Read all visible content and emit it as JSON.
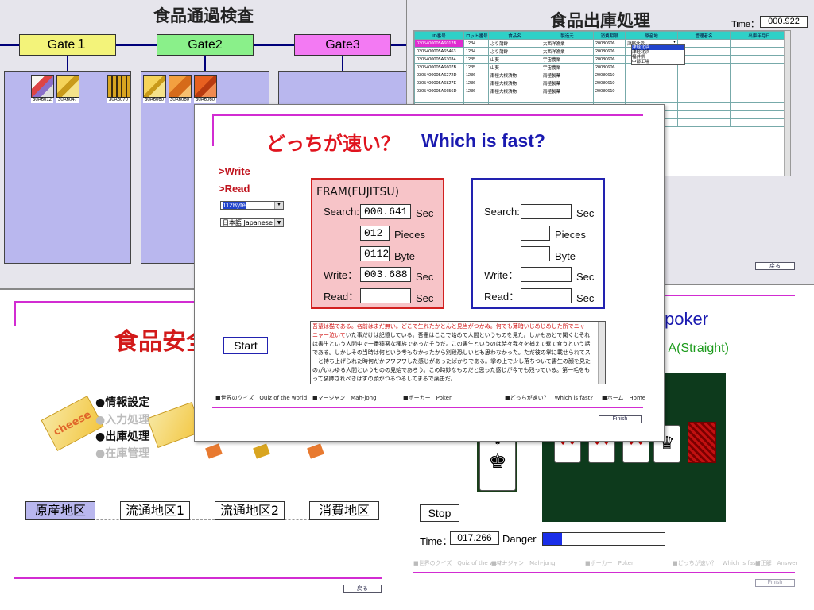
{
  "gates_panel": {
    "title": "食品通過検査",
    "gates": [
      "Gate１",
      "Gate2",
      "Gate3"
    ],
    "gate_colors": [
      "#f3f37a",
      "#8af08a",
      "#f37af3"
    ],
    "gate1_items": [
      "30A6012",
      "30A6047",
      "30A6070"
    ],
    "gate2_items": [
      "30A6060",
      "30A6060",
      "30A6060"
    ]
  },
  "shipping_panel": {
    "title": "食品出庫処理",
    "time_label": "Time：",
    "time_value": "000.922",
    "columns": [
      "ID番号",
      "ロット番号",
      "食品名",
      "製造元",
      "消費期限",
      "原産地",
      "管理者名",
      "出庫年月日"
    ],
    "rows": [
      [
        "0305400005A6012B",
        "1234",
        "ぶり蒲鉾",
        "大西洋漁業",
        "20080606",
        "津軽北浜"
      ],
      [
        "0305400005A65463",
        "1234",
        "ぶり蒲鉾",
        "大西洋漁業",
        "20080606",
        ""
      ],
      [
        "0305400005A63034",
        "1235",
        "山葵",
        "宇宙農業",
        "20080606",
        ""
      ],
      [
        "0305400005A6607B",
        "1235",
        "山葵",
        "宇宙農業",
        "20080606",
        ""
      ],
      [
        "0305400005A6272D",
        "1236",
        "南極大根漬物",
        "南極製菓",
        "20080610",
        ""
      ],
      [
        "0305400005A6827E",
        "1236",
        "南極大根漬物",
        "南極製菓",
        "20080610",
        ""
      ],
      [
        "0305400005A6656D",
        "1236",
        "南極大根漬物",
        "南極製菓",
        "20080610",
        ""
      ]
    ],
    "dropdown_options": [
      "津軽北浜",
      "津軽北浜",
      "福井県",
      "中部工場"
    ],
    "back_label": "戻る"
  },
  "safety_panel": {
    "title": "食品安全",
    "menu": [
      "●情報設定",
      "●入力処理",
      "●出庫処理",
      "●在庫管理"
    ],
    "regions": [
      "原産地区",
      "流通地区1",
      "流通地区2",
      "消費地区"
    ],
    "back_label": "戻る"
  },
  "poker_panel": {
    "title": "poker",
    "pattern": "n A(Straight)",
    "stop_label": "Stop",
    "time_label": "Time：",
    "time_value": "017.266",
    "danger_label": "Danger",
    "danger_level": 0.16,
    "nav": [
      "■世界のクイズ　Quiz of the world",
      "■マージャン　Mah-jong",
      "■ポーカー　Poker",
      "■どっちが速い？　Which is fast?",
      "■正解　Answer"
    ],
    "finish_label": "Finish"
  },
  "modal": {
    "title_jp": "どっちが速い？",
    "title_en": "Which is fast?",
    "write_label": ">Write",
    "read_label": ">Read",
    "size_select": "112Byte",
    "lang_select": "日本語 Japanese",
    "fram": {
      "title": "FRAM(FUJITSU)",
      "search_label": "Search:",
      "search_value": "000.641",
      "pieces_value": "012",
      "byte_value": "0112",
      "write_label": "Write：",
      "write_value": "003.688",
      "read_label": "Read：",
      "read_value": "",
      "unit_sec": "Sec",
      "unit_pieces": "Pieces",
      "unit_byte": "Byte"
    },
    "other": {
      "search_label": "Search:",
      "search_value": "",
      "pieces_value": "",
      "byte_value": "",
      "write_label": "Write：",
      "write_value": "",
      "read_label": "Read：",
      "read_value": "",
      "unit_sec": "Sec",
      "unit_pieces": "Pieces",
      "unit_byte": "Byte"
    },
    "start_label": "Start",
    "text_red": "吾輩は猫である。名前はまだ無い。どこで生れたかとんと見当がつかぬ。何でも薄暗いじめじめした所でニャーニャー泣いて",
    "text_black": "いた事だけは記憶している。吾輩はここで始めて人間というものを見た。しかもあとで聞くとそれは書生という人間中で一番獰悪な種族であったそうだ。この書生というのは時々我々を捕えて煮て食うという話である。しかしその当時は何という考もなかったから別段恐しいとも思わなかった。ただ彼の掌に載せられてスーと持ち上げられた時何だかフワフワした感じがあったばかりである。掌の上で少し落ちついて書生の顔を見たのがいわゆる人間というものの見始であろう。この時妙なものだと思った感じが今でも残っている。第一毛をもって装飾されべきはずの顔がつるつるしてまるで薬缶だ。",
    "nav": [
      "■世界のクイズ　Quiz of the world",
      "■マージャン　Mah-jong",
      "■ポーカー　Poker",
      "■どっちが速い？　Which is fast?",
      "■ホーム　Home"
    ],
    "finish_label": "Finish"
  }
}
